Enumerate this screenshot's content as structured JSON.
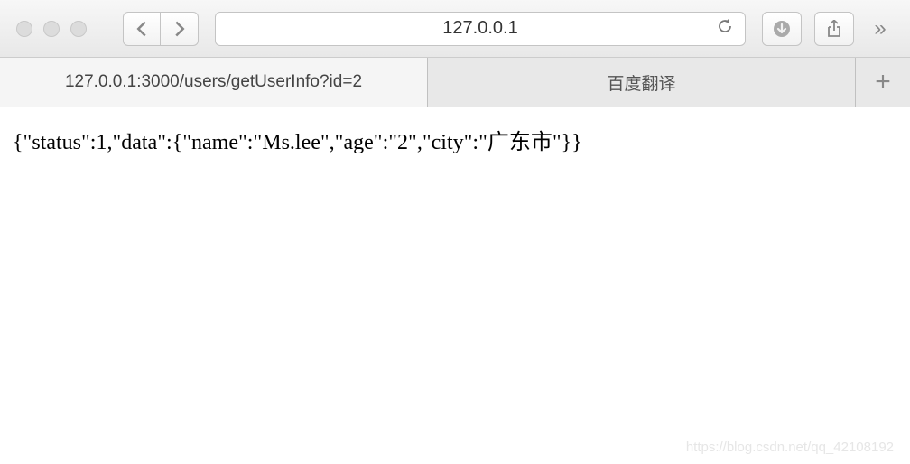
{
  "toolbar": {
    "url": "127.0.0.1"
  },
  "tabs": [
    {
      "label": "127.0.0.1:3000/users/getUserInfo?id=2",
      "active": true
    },
    {
      "label": "百度翻译",
      "active": false
    }
  ],
  "newTabLabel": "+",
  "content": {
    "body": "{\"status\":1,\"data\":{\"name\":\"Ms.lee\",\"age\":\"2\",\"city\":\"广东市\"}}"
  },
  "watermark": "https://blog.csdn.net/qq_42108192"
}
